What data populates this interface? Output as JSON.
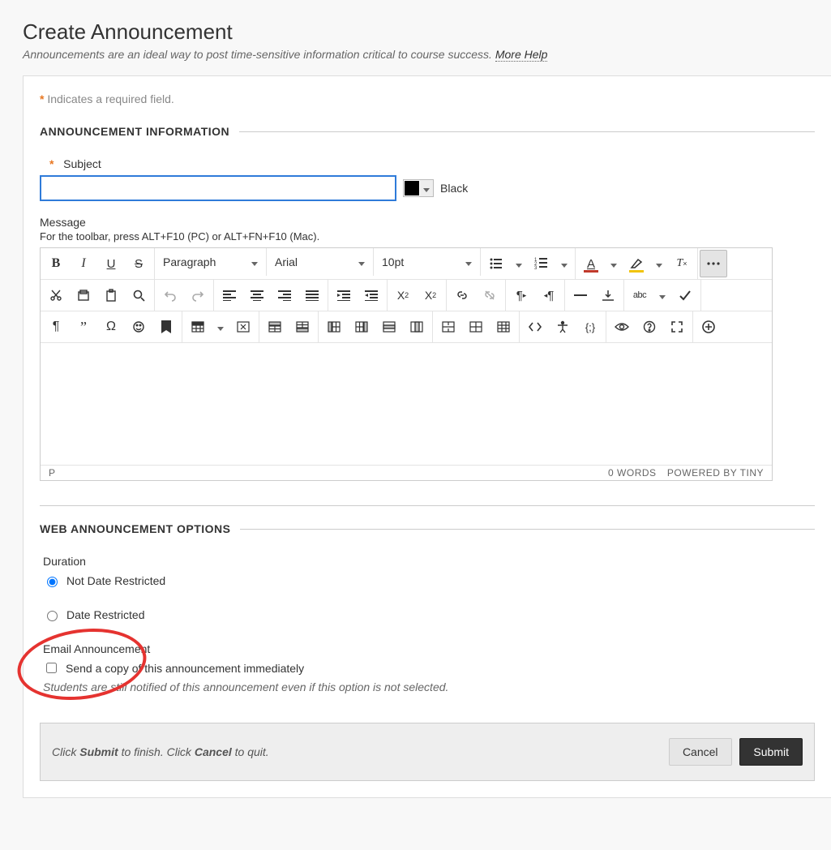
{
  "page": {
    "title": "Create Announcement",
    "subtitle": "Announcements are an ideal way to post time-sensitive information critical to course success.",
    "help_link": "More Help",
    "required_note": "Indicates a required field."
  },
  "section1": {
    "heading": "ANNOUNCEMENT INFORMATION",
    "subject_label": "Subject",
    "subject_value": "",
    "color_name": "Black",
    "message_label": "Message",
    "toolbar_hint": "For the toolbar, press ALT+F10 (PC) or ALT+FN+F10 (Mac).",
    "format_select": "Paragraph",
    "font_select": "Arial",
    "size_select": "10pt",
    "status_path": "P",
    "word_count": "0 WORDS",
    "powered": "POWERED BY TINY"
  },
  "section2": {
    "heading": "WEB ANNOUNCEMENT OPTIONS",
    "duration_label": "Duration",
    "opt_not_restricted": "Not Date Restricted",
    "opt_restricted": "Date Restricted",
    "email_heading": "Email Announcement",
    "email_checkbox": "Send a copy of this announcement immediately",
    "email_note": "Students are still notified of this announcement even if this option is not selected."
  },
  "footer": {
    "hint_pre": "Click ",
    "hint_submit": "Submit",
    "hint_mid": " to finish. Click ",
    "hint_cancel": "Cancel",
    "hint_post": " to quit.",
    "cancel": "Cancel",
    "submit": "Submit"
  }
}
